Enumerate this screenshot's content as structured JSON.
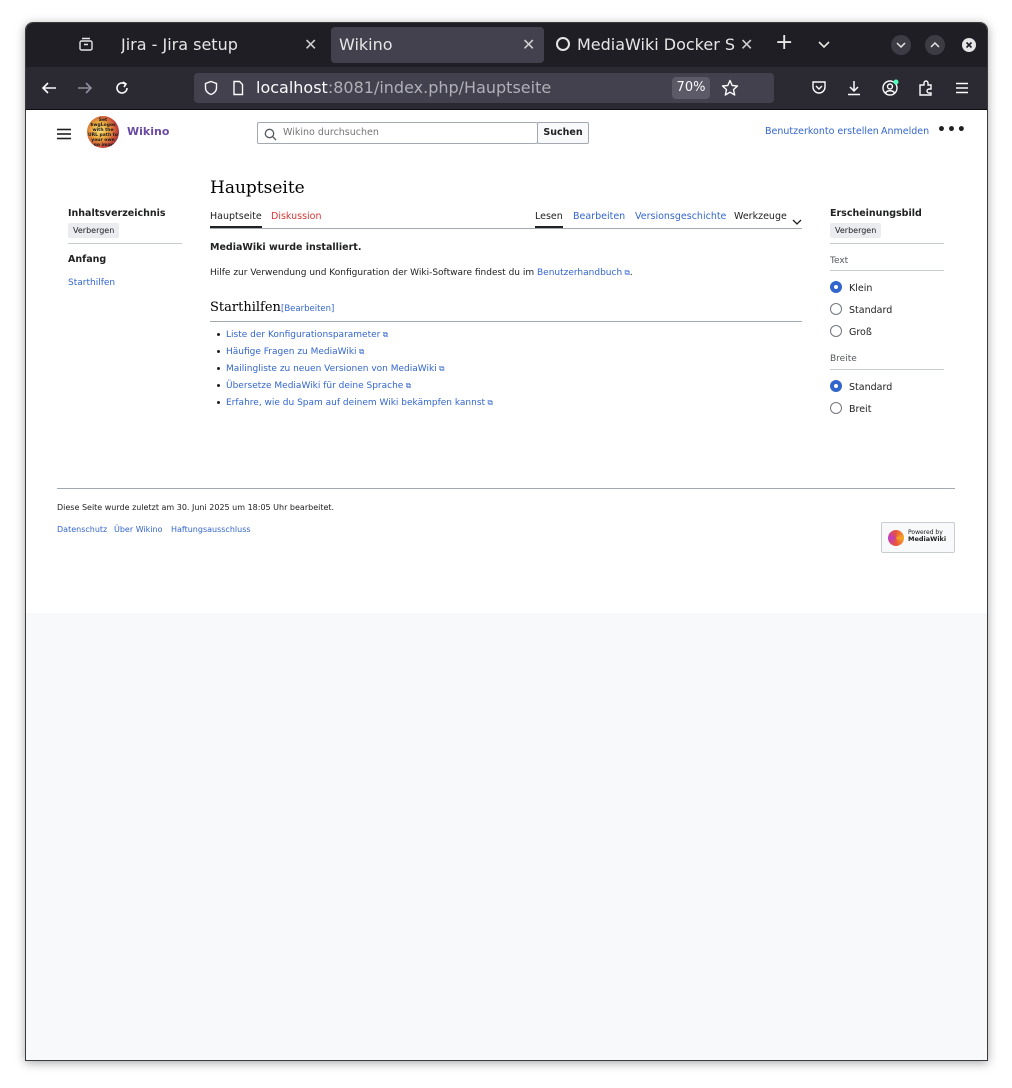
{
  "browser": {
    "tabs": [
      {
        "title": "Jira - Jira setup"
      },
      {
        "title": "Wikino"
      },
      {
        "title": "MediaWiki Docker Setu"
      }
    ],
    "url_host": "localhost",
    "url_rest": ":8081/index.php/Hauptseite",
    "zoom": "70%"
  },
  "header": {
    "site_name": "Wikino",
    "logo_text": "Set $wgLogos with the URL path to your own logo image",
    "search_placeholder": "Wikino durchsuchen",
    "search_button": "Suchen",
    "create_account": "Benutzerkonto erstellen",
    "login": "Anmelden"
  },
  "toc": {
    "title": "Inhaltsverzeichnis",
    "hide_button": "Verbergen",
    "start": "Anfang",
    "items": [
      "Starthilfen"
    ]
  },
  "article": {
    "title": "Hauptseite",
    "tab_page": "Hauptseite",
    "tab_discussion": "Diskussion",
    "tab_read": "Lesen",
    "tab_edit": "Bearbeiten",
    "tab_history": "Versionsgeschichte",
    "tab_tools": "Werkzeuge",
    "installed": "MediaWiki wurde installiert.",
    "help_prefix": "Hilfe zur Verwendung und Konfiguration der Wiki-Software findest du im ",
    "help_link": "Benutzerhandbuch",
    "help_suffix": ".",
    "section_title": "Starthilfen",
    "section_edit": "[Bearbeiten]",
    "links": [
      "Liste der Konfigurationsparameter",
      "Häufige Fragen zu MediaWiki",
      "Mailingliste zu neuen Versionen von MediaWiki",
      "Übersetze MediaWiki für deine Sprache",
      "Erfahre, wie du Spam auf deinem Wiki bekämpfen kannst"
    ]
  },
  "appearance": {
    "title": "Erscheinungsbild",
    "hide_button": "Verbergen",
    "text_label": "Text",
    "text_options": [
      "Klein",
      "Standard",
      "Groß"
    ],
    "text_selected": "Klein",
    "width_label": "Breite",
    "width_options": [
      "Standard",
      "Breit"
    ],
    "width_selected": "Standard"
  },
  "footer": {
    "last_modified": "Diese Seite wurde zuletzt am 30. Juni 2025 um 18:05 Uhr bearbeitet.",
    "links": [
      "Datenschutz",
      "Über Wikino",
      "Haftungsausschluss"
    ],
    "powered_line1": "Powered by",
    "powered_line2": "MediaWiki"
  }
}
